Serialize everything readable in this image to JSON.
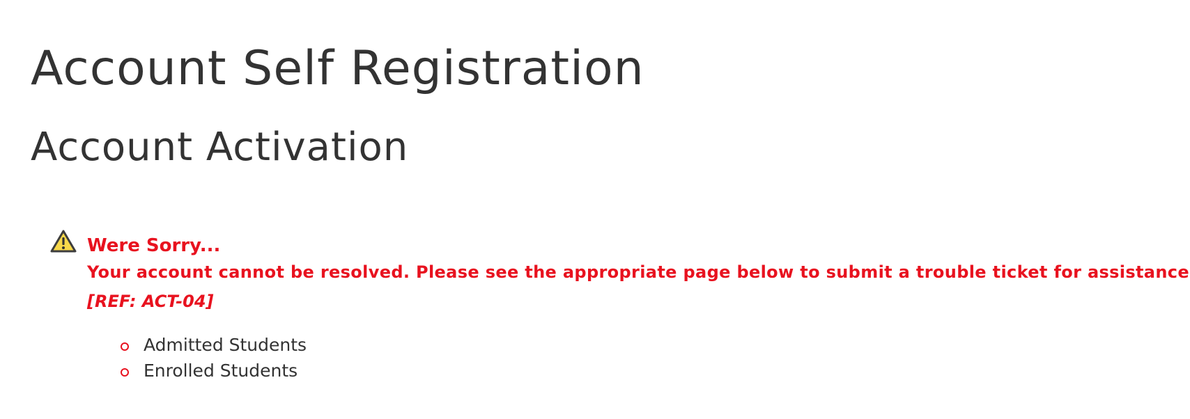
{
  "header": {
    "title": "Account Self Registration",
    "subtitle": "Account Activation"
  },
  "alert": {
    "icon": "warning-icon",
    "color": "#e8121f",
    "heading": "Were Sorry...",
    "message": "Your account cannot be resolved. Please see the appropriate page below to submit a trouble ticket for assistance.",
    "reference": "[REF: ACT-04]"
  },
  "links": [
    {
      "label": "Admitted Students"
    },
    {
      "label": "Enrolled Students"
    }
  ]
}
